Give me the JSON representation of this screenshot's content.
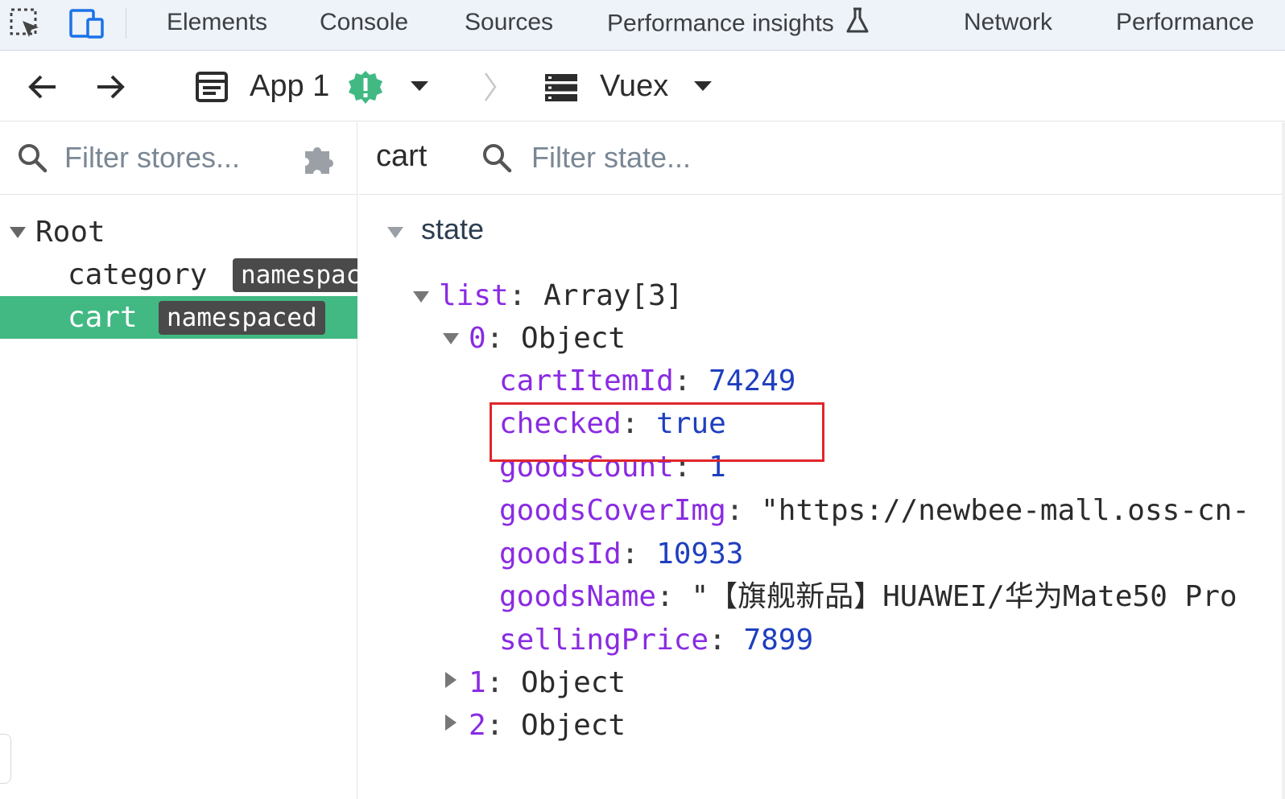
{
  "tabbar": {
    "tabs": [
      "Elements",
      "Console",
      "Sources",
      "Performance insights",
      "Network",
      "Performance"
    ]
  },
  "toolbar": {
    "app_label": "App 1",
    "app_badge": "!",
    "plugin_label": "Vuex"
  },
  "left": {
    "filter_placeholder": "Filter stores...",
    "tree": [
      {
        "label": "Root",
        "badge": ""
      },
      {
        "label": "category",
        "badge": "namespaced"
      },
      {
        "label": "cart",
        "badge": "namespaced"
      }
    ]
  },
  "right": {
    "store_name": "cart",
    "filter_placeholder": "Filter state...",
    "section": "state",
    "list_key": "list",
    "list_value": "Array[3]",
    "items": [
      {
        "index": "0",
        "value": "Object"
      },
      {
        "index": "1",
        "value": "Object"
      },
      {
        "index": "2",
        "value": "Object"
      }
    ],
    "fields": [
      {
        "key": "cartItemId",
        "value": "74249"
      },
      {
        "key": "checked",
        "value": "true"
      },
      {
        "key": "goodsCount",
        "value": "1"
      },
      {
        "key": "goodsCoverImg",
        "value": "\"https://newbee-mall.oss-cn-"
      },
      {
        "key": "goodsId",
        "value": "10933"
      },
      {
        "key": "goodsName",
        "value": "\"【旗舰新品】HUAWEI/华为Mate50 Pro"
      },
      {
        "key": "sellingPrice",
        "value": "7899"
      }
    ]
  },
  "colors": {
    "selected_row": "#42b983",
    "highlight": "#e0262b",
    "warning_badge": "#42b983"
  }
}
